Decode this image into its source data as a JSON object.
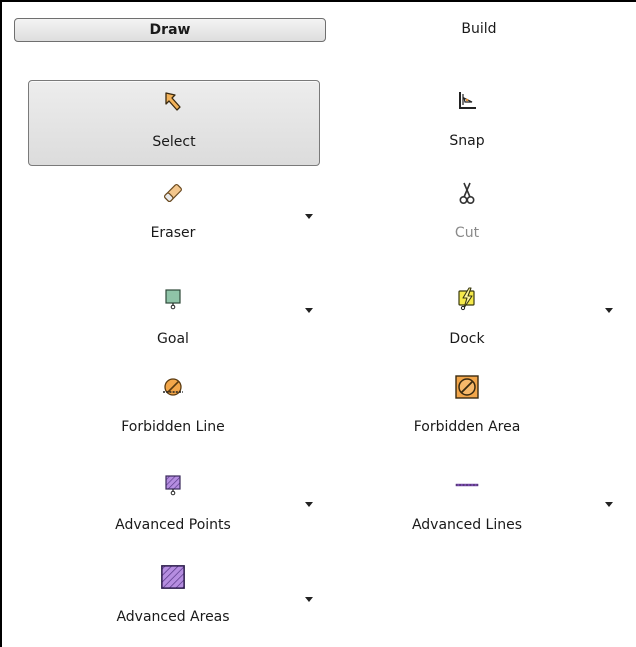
{
  "tabs": {
    "draw": "Draw",
    "build": "Build"
  },
  "tools": {
    "select": "Select",
    "snap": "Snap",
    "eraser": "Eraser",
    "cut": "Cut",
    "goal": "Goal",
    "dock": "Dock",
    "forbidden_line": "Forbidden Line",
    "forbidden_area": "Forbidden Area",
    "advanced_points": "Advanced Points",
    "advanced_lines": "Advanced Lines",
    "advanced_areas": "Advanced Areas"
  },
  "icons": {
    "select": "select-arrow-icon",
    "snap": "snap-icon",
    "eraser": "eraser-icon",
    "cut": "scissors-icon",
    "goal": "goal-icon",
    "dock": "dock-icon",
    "forbidden_line": "forbidden-line-icon",
    "forbidden_area": "forbidden-area-icon",
    "advanced_points": "advanced-points-icon",
    "advanced_lines": "advanced-lines-icon",
    "advanced_areas": "advanced-areas-icon"
  },
  "selected_tool": "Select",
  "colors": {
    "accent_orange": "#f0a040",
    "goal_green": "#7fb89a",
    "dock_yellow": "#f2e23a",
    "advanced_purple": "#9b6fd0",
    "disabled_text": "#8a8a8a"
  }
}
